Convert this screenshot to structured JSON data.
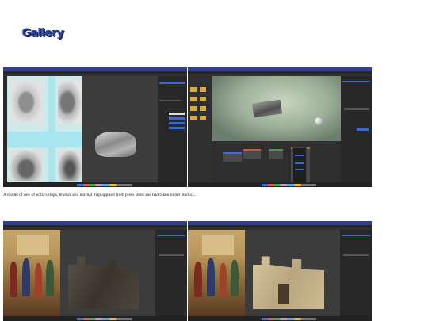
{
  "header": {
    "title": "Gallery"
  },
  "gallery": {
    "caption_1": "A model of one of willa's rings, texture and normal map applied from press shots she had taken in her studio..."
  },
  "colors": {
    "title_blue": "#2c3f8f",
    "blender_titlebar": "#2f3e9e",
    "viewport_dark": "#3a3a3a"
  }
}
